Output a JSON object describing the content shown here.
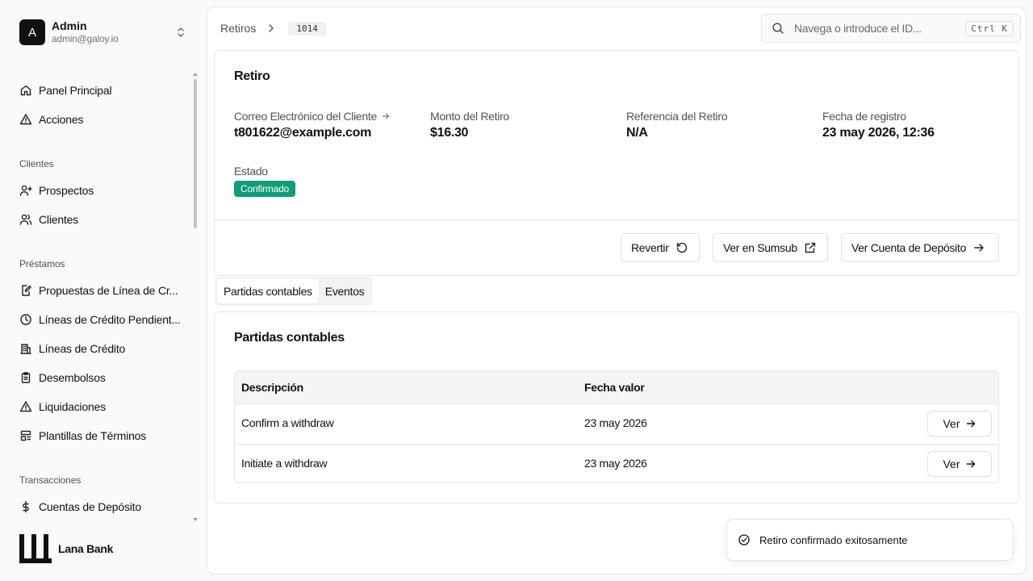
{
  "user": {
    "initial": "A",
    "name": "Admin",
    "email": "admin@galoy.io"
  },
  "nav": {
    "top": [
      {
        "label": "Panel Principal",
        "icon": "home-icon"
      },
      {
        "label": "Acciones",
        "icon": "warning-icon"
      }
    ],
    "groups": [
      {
        "title": "Clientes",
        "items": [
          {
            "label": "Prospectos",
            "icon": "user-plus-icon"
          },
          {
            "label": "Clientes",
            "icon": "users-icon"
          }
        ]
      },
      {
        "title": "Préstamos",
        "items": [
          {
            "label": "Propuestas de Línea de Cr...",
            "icon": "file-edit-icon"
          },
          {
            "label": "Líneas de Crédito Pendient...",
            "icon": "clock-icon"
          },
          {
            "label": "Líneas de Crédito",
            "icon": "building-icon"
          },
          {
            "label": "Desembolsos",
            "icon": "clipboard-icon"
          },
          {
            "label": "Liquidaciones",
            "icon": "warning-icon"
          },
          {
            "label": "Plantillas de Términos",
            "icon": "template-icon"
          }
        ]
      },
      {
        "title": "Transacciones",
        "items": [
          {
            "label": "Cuentas de Depósito",
            "icon": "dollar-icon"
          }
        ]
      }
    ]
  },
  "brand": {
    "name": "Lana Bank"
  },
  "breadcrumb": {
    "parent": "Retiros",
    "id": "1014"
  },
  "search": {
    "placeholder": "Navega o introduce el ID...",
    "shortcut": "Ctrl K"
  },
  "withdrawal": {
    "title": "Retiro",
    "fields": {
      "email_label": "Correo Electrónico del Cliente",
      "email_value": "t801622@example.com",
      "amount_label": "Monto del Retiro",
      "amount_value": "$16.30",
      "reference_label": "Referencia del Retiro",
      "reference_value": "N/A",
      "date_label": "Fecha de registro",
      "date_value": "23 may 2026, 12:36",
      "status_label": "Estado",
      "status_value": "Confirmado"
    },
    "actions": {
      "revert": "Revertir",
      "sumsub": "Ver en Sumsub",
      "deposit_account": "Ver Cuenta de Depósito"
    }
  },
  "tabs": [
    {
      "label": "Partidas contables",
      "active": true
    },
    {
      "label": "Eventos",
      "active": false
    }
  ],
  "entries": {
    "title": "Partidas contables",
    "columns": [
      "Descripción",
      "Fecha valor"
    ],
    "rows": [
      {
        "description": "Confirm a withdraw",
        "date": "23 may 2026",
        "action": "Ver"
      },
      {
        "description": "Initiate a withdraw",
        "date": "23 may 2026",
        "action": "Ver"
      }
    ]
  },
  "toast": {
    "message": "Retiro confirmado exitosamente"
  },
  "colors": {
    "badge": "#0f9d7a",
    "text": "#0a0a0a",
    "muted": "#525252",
    "border": "#e5e5e5"
  }
}
